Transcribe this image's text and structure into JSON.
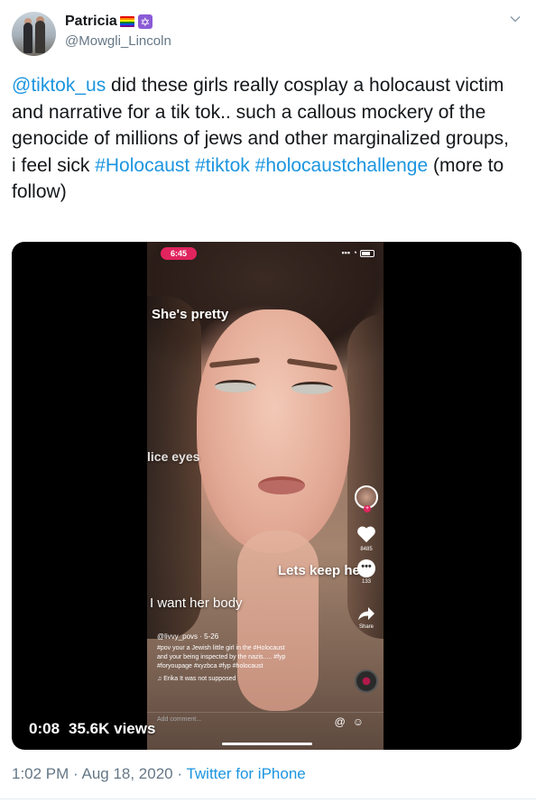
{
  "author": {
    "display_name": "Patricia",
    "handle": "@Mowgli_Lincoln",
    "name_emojis": [
      "rainbow-flag",
      "star-of-david"
    ]
  },
  "tweet": {
    "mention": "@tiktok_us",
    "text_main": " did these girls really cosplay a holocaust victim and narrative for a tik tok.. such a callous mockery of the genocide of millions of jews and other marginalized groups, i feel sick ",
    "hashtags": [
      "#Holocaust",
      "#tiktok",
      "#holocaustchallenge"
    ],
    "text_tail": " (more to follow)"
  },
  "video": {
    "time_label": "0:08",
    "views_label": "35.6K views",
    "progress_fraction": 0.18,
    "tiktok_overlay": {
      "status_time": "6:45",
      "caption_1": "She's pretty",
      "caption_2": "lice eyes",
      "caption_3": "Lets keep her",
      "caption_4": "I want her body",
      "likes_count": "8485",
      "comments_count": "133",
      "share_label": "Share",
      "username_line": "@livvy_povs · 5-26",
      "description_1": "#pov your a Jewish little girl in the #Holocaust",
      "description_2": "and your being inspected by the nazis..... #fyp",
      "description_3": "#foryoupage #xyzbca #fyp #holocaust",
      "music_line": "Erika   It was not supposed",
      "add_comment": "Add comment..."
    }
  },
  "footer": {
    "time": "1:02 PM",
    "date": "Aug 18, 2020",
    "source": "Twitter for iPhone"
  },
  "colors": {
    "link": "#1b95e0",
    "secondary_text": "#657786",
    "primary_text": "#14171a"
  }
}
